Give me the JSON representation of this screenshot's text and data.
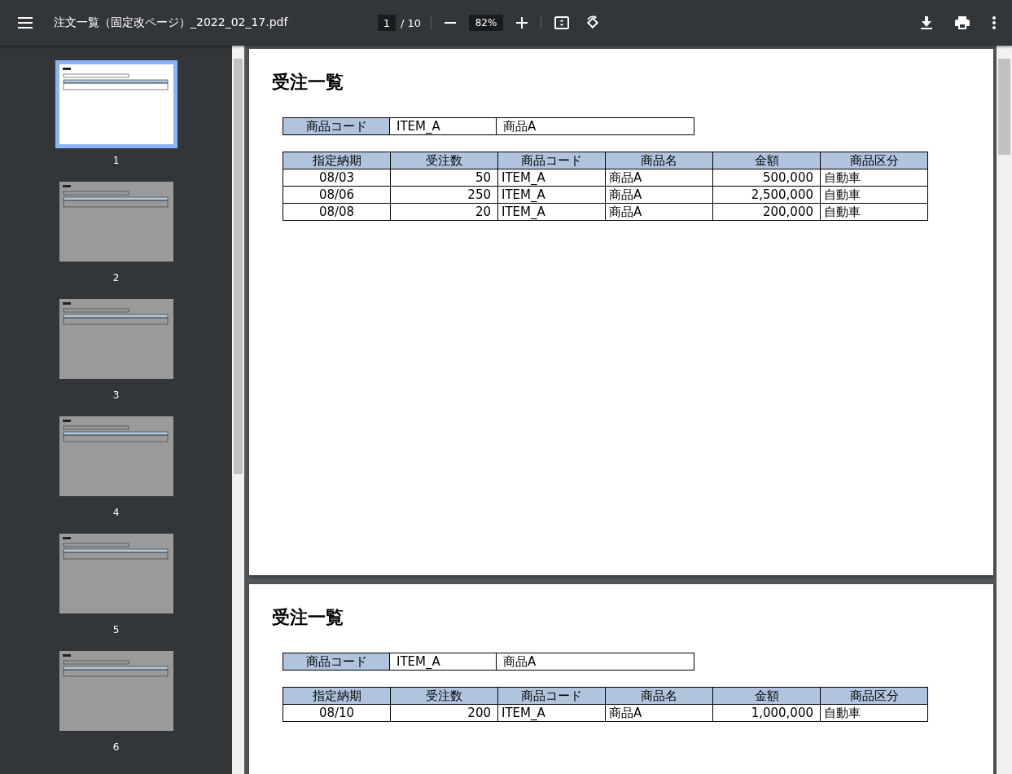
{
  "toolbar": {
    "title": "注文一覧（固定改ページ）_2022_02_17.pdf",
    "page_current": "1",
    "page_total": "/ 10",
    "zoom": "82%"
  },
  "thumbnails": [
    {
      "label": "1",
      "selected": true
    },
    {
      "label": "2",
      "selected": false
    },
    {
      "label": "3",
      "selected": false
    },
    {
      "label": "4",
      "selected": false
    },
    {
      "label": "5",
      "selected": false
    },
    {
      "label": "6",
      "selected": false
    }
  ],
  "pages": [
    {
      "title": "受注一覧",
      "item": {
        "label": "商品コード",
        "code": "ITEM_A",
        "name": "商品A"
      },
      "columns": [
        "指定納期",
        "受注数",
        "商品コード",
        "商品名",
        "金額",
        "商品区分"
      ],
      "rows": [
        [
          "08/03",
          "50",
          "ITEM_A",
          "商品A",
          "500,000",
          "自動車"
        ],
        [
          "08/06",
          "250",
          "ITEM_A",
          "商品A",
          "2,500,000",
          "自動車"
        ],
        [
          "08/08",
          "20",
          "ITEM_A",
          "商品A",
          "200,000",
          "自動車"
        ]
      ]
    },
    {
      "title": "受注一覧",
      "item": {
        "label": "商品コード",
        "code": "ITEM_A",
        "name": "商品A"
      },
      "columns": [
        "指定納期",
        "受注数",
        "商品コード",
        "商品名",
        "金額",
        "商品区分"
      ],
      "rows": [
        [
          "08/10",
          "200",
          "ITEM_A",
          "商品A",
          "1,000,000",
          "自動車"
        ]
      ]
    }
  ]
}
